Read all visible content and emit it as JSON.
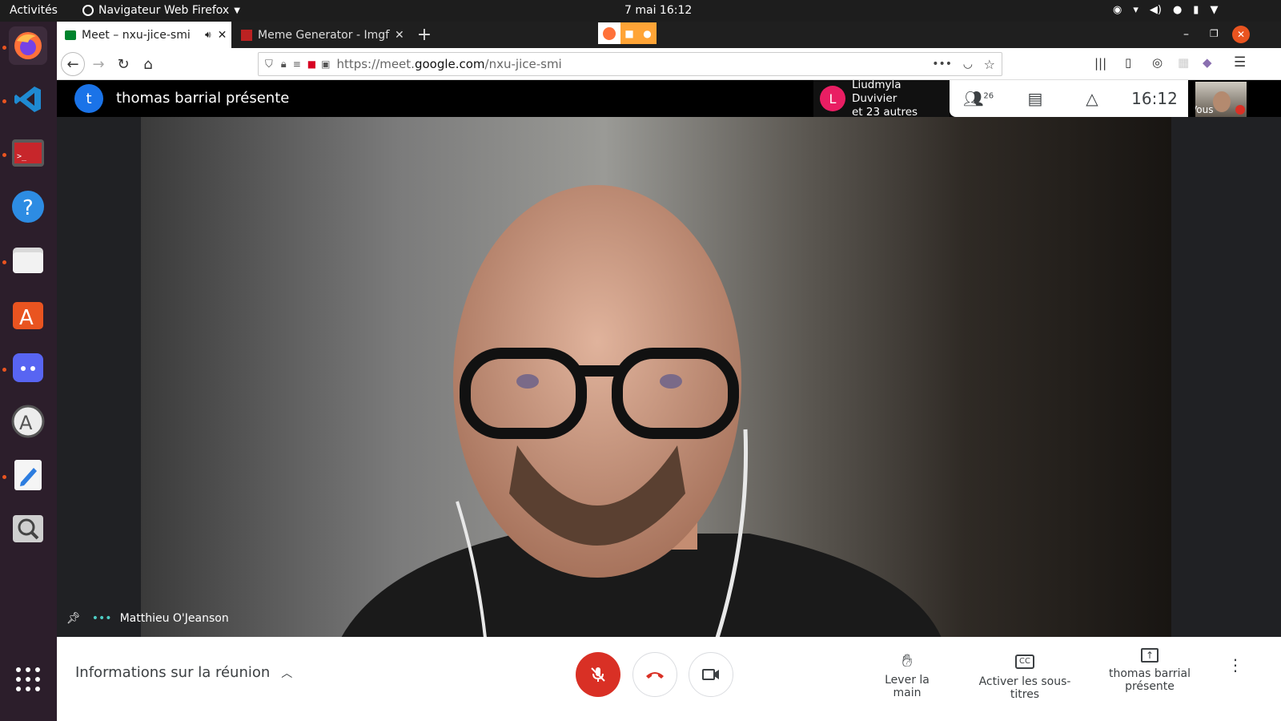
{
  "system_bar": {
    "activities": "Activités",
    "app_name": "Navigateur Web Firefox",
    "datetime": "7 mai  16:12"
  },
  "dock": {
    "items": [
      "firefox-icon",
      "vscode-icon",
      "terminal-icon",
      "help-icon",
      "files-icon",
      "software-icon",
      "discord-icon",
      "update-icon",
      "text-editor-icon",
      "screenshot-icon"
    ]
  },
  "browser": {
    "tabs": [
      {
        "label": "Meet – nxu-jice-smi",
        "active": true
      },
      {
        "label": "Meme Generator - Imgfli",
        "active": false
      }
    ],
    "url_prefix": "https://meet.",
    "url_domain": "google.com",
    "url_path": "/nxu-jice-smi"
  },
  "meet": {
    "presenter_initial": "t",
    "presenter_title": "thomas barrial présente",
    "participant_initial": "L",
    "participant_name": "Liudmyla Duvivier",
    "participant_others": "et 23 autres",
    "people_count": "26",
    "clock": "16:12",
    "self_label": "Vous",
    "speaker_name": "Matthieu O'Jeanson",
    "meeting_info": "Informations sur la réunion",
    "raise_hand": "Lever la main",
    "captions": "Activer les sous-titres",
    "presenting_line1": "thomas barrial",
    "presenting_line2": "présente"
  },
  "colors": {
    "meet_red": "#d93025",
    "avatar_blue": "#1a73e8",
    "avatar_pink": "#e91e63",
    "dock_bg": "#2c1e2b"
  }
}
